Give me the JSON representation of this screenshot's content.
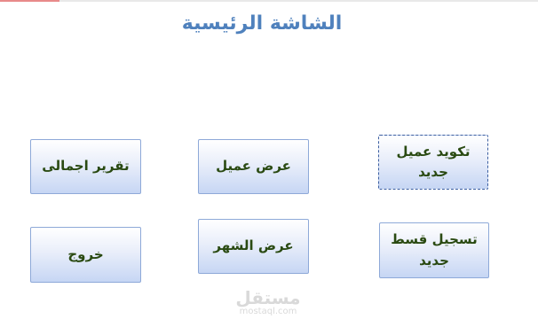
{
  "header": {
    "title": "الشاشة الرئيسية"
  },
  "buttons": {
    "new_customer_code": "تكويد عميل جديد",
    "view_customer": "عرض عميل",
    "summary_report": "تقرير اجمالى",
    "new_installment": "تسجيل قسط جديد",
    "view_month": "عرض الشهر",
    "exit": "خروج"
  },
  "watermark": {
    "arabic": "مستقل",
    "latin": "mostaql.com"
  },
  "colors": {
    "title": "#4f81bd",
    "button_text": "#2a4a12",
    "button_border": "#8ea9d8"
  }
}
